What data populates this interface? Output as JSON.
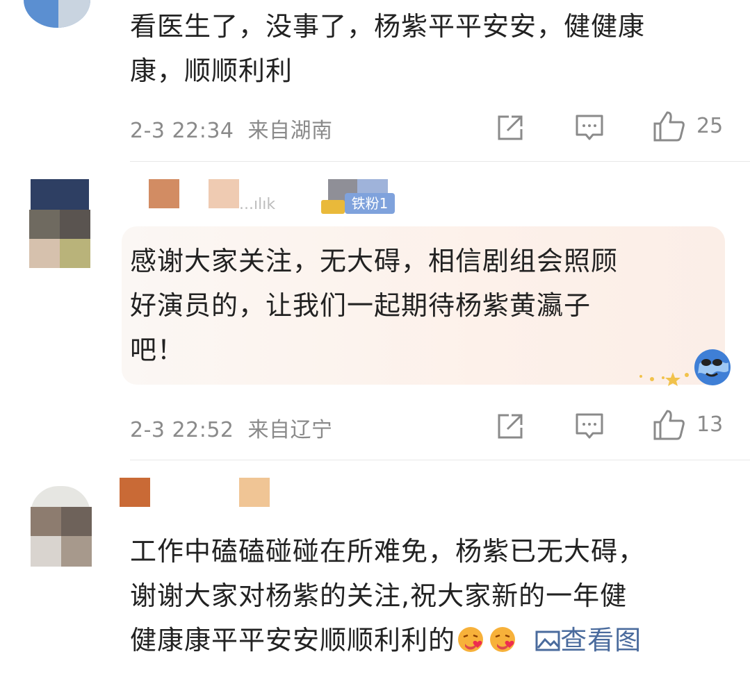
{
  "comments": [
    {
      "text": "看医生了，没事了，杨紫平平安安，健健康康，顺顺利利",
      "line1": "看医生了，没事了，杨紫平平安安，健健康",
      "line2": "康，顺顺利利",
      "time": "2-3 22:34",
      "location": "来自湖南",
      "likes": "25"
    },
    {
      "username_fragment": "...ılık",
      "badge": "铁粉1",
      "text": "感谢大家关注，无大碍，相信剧组会照顾好演员的，让我们一起期待杨紫黄瀛子吧！",
      "line1": "感谢大家关注，无大碍，相信剧组会照顾",
      "line2": "好演员的，让我们一起期待杨紫黄瀛子",
      "line3": "吧！",
      "time": "2-3 22:52",
      "location": "来自辽宁",
      "likes": "13"
    },
    {
      "text": "工作中磕磕碰碰在所难免，杨紫已无大碍，谢谢大家对杨紫的关注,祝大家新的一年健健康康平平安安顺顺利利的",
      "line1": "工作中磕磕碰碰在所难免，杨紫已无大碍，",
      "line2": "谢谢大家对杨紫的关注,祝大家新的一年健",
      "line3": "健康康平平安安顺顺利利的",
      "view_image": "查看图"
    }
  ],
  "icons": {
    "share": "share-icon",
    "comment": "comment-icon",
    "like": "thumbs-up-icon",
    "image": "image-icon",
    "emoji": "kiss-emoji-icon",
    "sticker": "globe-sticker-icon"
  },
  "colors": {
    "text": "#222222",
    "meta": "#8a8a8a",
    "link": "#4a6b9d",
    "badge": "#7fa2dc",
    "divider": "#e8e8e8"
  }
}
